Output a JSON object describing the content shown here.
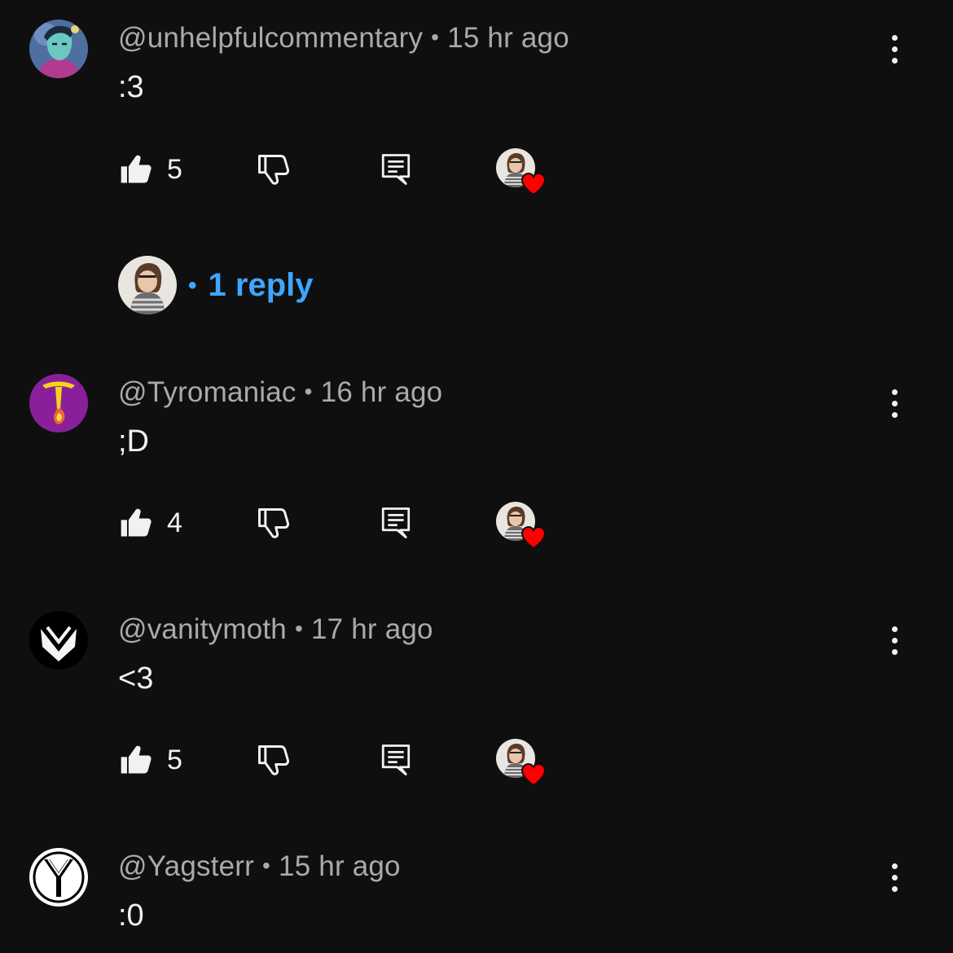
{
  "colors": {
    "background": "#0f0f0f",
    "meta_text": "#aaaaaa",
    "body_text": "#f1f1f1",
    "reply_link": "#3ea6ff",
    "heart": "#ff0000"
  },
  "separator": "•",
  "icons": {
    "like": "thumb-up-icon",
    "dislike": "thumb-down-icon",
    "reply": "comment-reply-icon",
    "more": "more-vertical-icon",
    "creator_heart": "creator-heart-icon"
  },
  "comments": [
    {
      "username": "@unhelpfulcommentary",
      "time": "15 hr ago",
      "text": ":3",
      "likes": "5",
      "hearted": true,
      "replies_label": "1 reply"
    },
    {
      "username": "@Tyromaniac",
      "time": "16 hr ago",
      "text": ";D",
      "likes": "4",
      "hearted": true
    },
    {
      "username": "@vanitymoth",
      "time": "17 hr ago",
      "text": "<3",
      "likes": "5",
      "hearted": true
    },
    {
      "username": "@Yagsterr",
      "time": "15 hr ago",
      "text": ":0"
    }
  ]
}
